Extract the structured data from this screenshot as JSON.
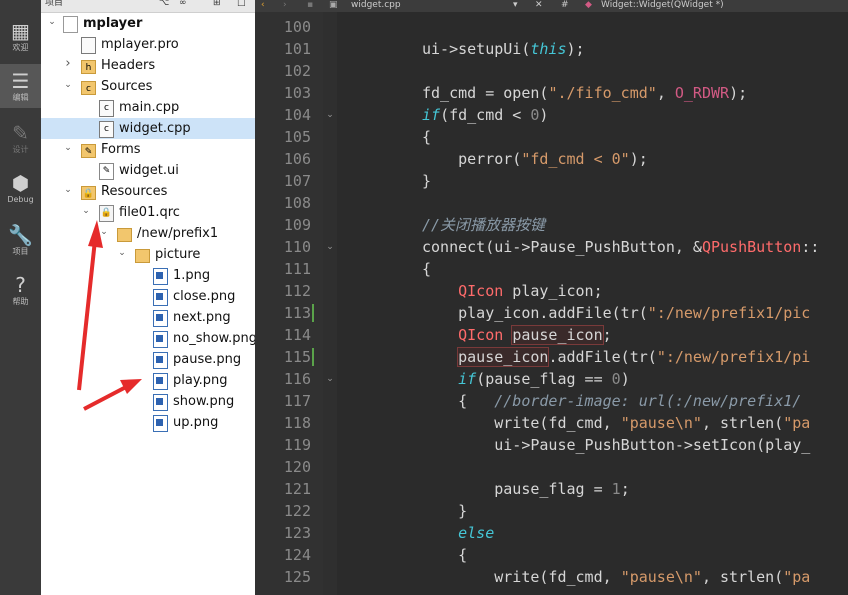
{
  "modebar": [
    {
      "label": "欢迎",
      "icon": "grid-icon",
      "active": false,
      "dim": false
    },
    {
      "label": "编辑",
      "icon": "edit-icon",
      "active": true,
      "dim": false
    },
    {
      "label": "设计",
      "icon": "design-icon",
      "active": false,
      "dim": true
    },
    {
      "label": "Debug",
      "icon": "debug-icon",
      "active": false,
      "dim": false
    },
    {
      "label": "项目",
      "icon": "wrench-icon",
      "active": false,
      "dim": false
    },
    {
      "label": "帮助",
      "icon": "help-icon",
      "active": false,
      "dim": false
    }
  ],
  "tree_toolbar": {
    "title": "项目"
  },
  "tree": [
    {
      "label": "mplayer",
      "icon": "project-icon",
      "arrow": "▼",
      "indent": 0,
      "bold": true
    },
    {
      "label": "mplayer.pro",
      "icon": "pro-file-icon",
      "arrow": "",
      "indent": 1
    },
    {
      "label": "Headers",
      "icon": "headers-folder-icon",
      "arrow": "›",
      "indent": 1
    },
    {
      "label": "Sources",
      "icon": "sources-folder-icon",
      "arrow": "▾",
      "indent": 1
    },
    {
      "label": "main.cpp",
      "icon": "cpp-file-icon",
      "arrow": "",
      "indent": 2
    },
    {
      "label": "widget.cpp",
      "icon": "cpp-file-icon",
      "arrow": "",
      "indent": 2,
      "selected": true
    },
    {
      "label": "Forms",
      "icon": "forms-folder-icon",
      "arrow": "▾",
      "indent": 1
    },
    {
      "label": "widget.ui",
      "icon": "ui-file-icon",
      "arrow": "",
      "indent": 2
    },
    {
      "label": "Resources",
      "icon": "resources-folder-icon",
      "arrow": "▾",
      "indent": 1
    },
    {
      "label": "file01.qrc",
      "icon": "qrc-file-icon",
      "arrow": "▾",
      "indent": 2
    },
    {
      "label": "/new/prefix1",
      "icon": "folder-icon",
      "arrow": "▾",
      "indent": 3
    },
    {
      "label": "picture",
      "icon": "folder-icon",
      "arrow": "▾",
      "indent": 4
    },
    {
      "label": "1.png",
      "icon": "png-file-icon",
      "arrow": "",
      "indent": 5
    },
    {
      "label": "close.png",
      "icon": "png-file-icon",
      "arrow": "",
      "indent": 5
    },
    {
      "label": "next.png",
      "icon": "png-file-icon",
      "arrow": "",
      "indent": 5
    },
    {
      "label": "no_show.png",
      "icon": "png-file-icon",
      "arrow": "",
      "indent": 5
    },
    {
      "label": "pause.png",
      "icon": "png-file-icon",
      "arrow": "",
      "indent": 5
    },
    {
      "label": "play.png",
      "icon": "png-file-icon",
      "arrow": "",
      "indent": 5
    },
    {
      "label": "show.png",
      "icon": "png-file-icon",
      "arrow": "",
      "indent": 5
    },
    {
      "label": "up.png",
      "icon": "png-file-icon",
      "arrow": "",
      "indent": 5
    }
  ],
  "editor_toolbar": {
    "file": "widget.cpp",
    "hash": "#",
    "symbol": "Widget::Widget(QWidget *)"
  },
  "lines": [
    {
      "n": "100",
      "fold": "",
      "chg": false
    },
    {
      "n": "101",
      "fold": "",
      "chg": false
    },
    {
      "n": "102",
      "fold": "",
      "chg": false
    },
    {
      "n": "103",
      "fold": "",
      "chg": false
    },
    {
      "n": "104",
      "fold": "▾",
      "chg": false
    },
    {
      "n": "105",
      "fold": "",
      "chg": false
    },
    {
      "n": "106",
      "fold": "",
      "chg": false
    },
    {
      "n": "107",
      "fold": "",
      "chg": false
    },
    {
      "n": "108",
      "fold": "",
      "chg": false
    },
    {
      "n": "109",
      "fold": "",
      "chg": false
    },
    {
      "n": "110",
      "fold": "▾",
      "chg": false
    },
    {
      "n": "111",
      "fold": "",
      "chg": false
    },
    {
      "n": "112",
      "fold": "",
      "chg": false
    },
    {
      "n": "113",
      "fold": "",
      "chg": true
    },
    {
      "n": "114",
      "fold": "",
      "chg": false
    },
    {
      "n": "115",
      "fold": "",
      "chg": true
    },
    {
      "n": "116",
      "fold": "▾",
      "chg": false
    },
    {
      "n": "117",
      "fold": "",
      "chg": false
    },
    {
      "n": "118",
      "fold": "",
      "chg": false
    },
    {
      "n": "119",
      "fold": "",
      "chg": false
    },
    {
      "n": "120",
      "fold": "",
      "chg": false
    },
    {
      "n": "121",
      "fold": "",
      "chg": false
    },
    {
      "n": "122",
      "fold": "",
      "chg": false
    },
    {
      "n": "123",
      "fold": "",
      "chg": false
    },
    {
      "n": "124",
      "fold": "",
      "chg": false
    },
    {
      "n": "125",
      "fold": "",
      "chg": false
    }
  ],
  "code": [
    "",
    "ui->setupUi(this);",
    "",
    "fd_cmd = open(\"./fifo_cmd\", O_RDWR);",
    "if(fd_cmd < 0)",
    "{",
    "    perror(\"fd_cmd < 0\");",
    "}",
    "",
    "//关闭播放器按键",
    "connect(ui->Pause_PushButton, &QPushButton::",
    "{",
    "    QIcon play_icon;",
    "    play_icon.addFile(tr(\":/new/prefix1/pic",
    "    QIcon pause_icon;",
    "    pause_icon.addFile(tr(\":/new/prefix1/pi",
    "    if(pause_flag == 0)",
    "    {   //border-image: url(:/new/prefix1/",
    "        write(fd_cmd, \"pause\\n\", strlen(\"pa",
    "        ui->Pause_PushButton->setIcon(play_",
    "",
    "        pause_flag = 1;",
    "    }",
    "    else",
    "    {",
    "        write(fd_cmd, \"pause\\n\", strlen(\"pa"
  ]
}
